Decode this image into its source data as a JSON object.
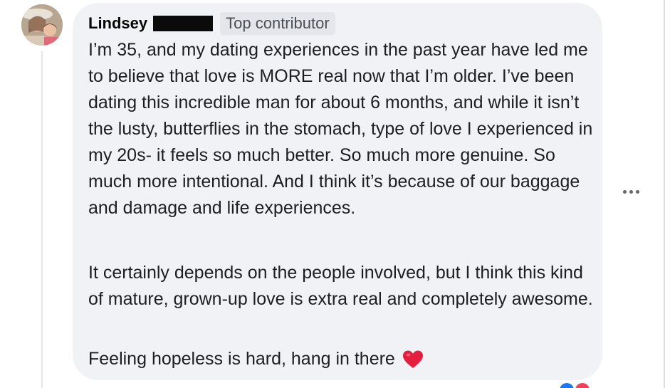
{
  "comment": {
    "author": "Lindsey",
    "badge": "Top contributor",
    "paragraphs": [
      "I’m 35, and my dating experiences in the past year have led me to believe that love is MORE real now that I’m older. I’ve been dating this incredible man for about 6 months, and while it isn’t the lusty, butterflies in the stomach, type of love I experienced in my 20s- it feels so much better. So much more genuine. So much more intentional. And I think it’s because of our baggage and damage and life experiences.",
      "It certainly depends on the people involved, but I think this kind of mature, grown-up love is extra real and completely awesome.",
      "Feeling hopeless is hard, hang in there"
    ],
    "emoji": "heart-icon",
    "more_icon": "more-options-icon"
  },
  "colors": {
    "bubble": "#f0f2f5",
    "text": "#1c1e21",
    "badge_bg": "#e4e6eb",
    "heart": "#e41e3f"
  }
}
